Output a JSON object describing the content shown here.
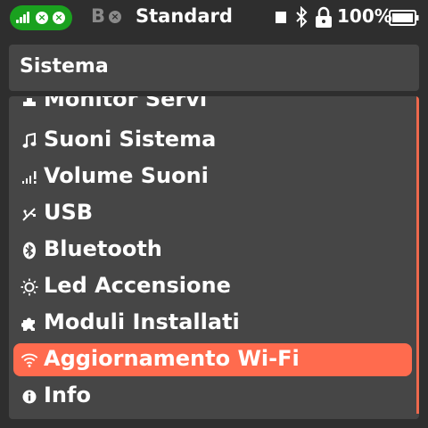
{
  "status_bar": {
    "bt_letter": "B",
    "mode": "Standard",
    "battery": "100%"
  },
  "title": "Sistema",
  "menu": {
    "items": [
      {
        "label": "Monitor Servi",
        "icon": "servo-icon"
      },
      {
        "label": "Suoni Sistema",
        "icon": "music-note-icon"
      },
      {
        "label": "Volume Suoni",
        "icon": "volume-icon"
      },
      {
        "label": "USB",
        "icon": "usb-icon"
      },
      {
        "label": "Bluetooth",
        "icon": "bluetooth-icon"
      },
      {
        "label": "Led Accensione",
        "icon": "sun-icon"
      },
      {
        "label": "Moduli Installati",
        "icon": "puzzle-icon"
      },
      {
        "label": "Aggiornamento Wi-Fi",
        "icon": "wifi-icon",
        "selected": true
      },
      {
        "label": "Info",
        "icon": "info-icon"
      }
    ]
  },
  "colors": {
    "background": "#2e2e2e",
    "panel": "#464646",
    "accent": "#ff6b4e",
    "status_green": "#1aa11f"
  }
}
